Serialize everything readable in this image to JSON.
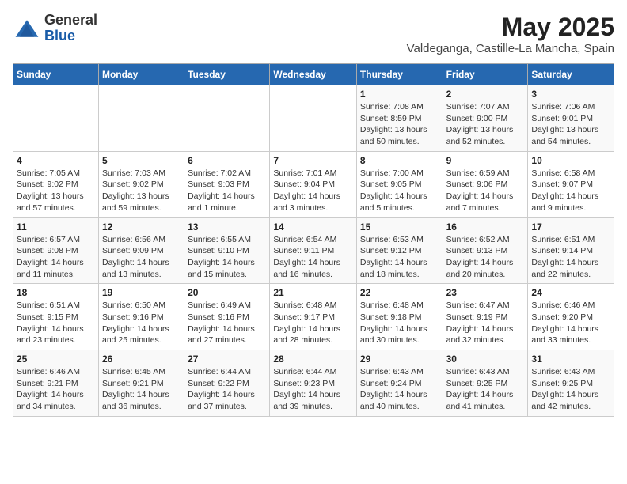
{
  "header": {
    "logo_general": "General",
    "logo_blue": "Blue",
    "month": "May 2025",
    "location": "Valdeganga, Castille-La Mancha, Spain"
  },
  "days_of_week": [
    "Sunday",
    "Monday",
    "Tuesday",
    "Wednesday",
    "Thursday",
    "Friday",
    "Saturday"
  ],
  "weeks": [
    [
      {
        "day": "",
        "info": ""
      },
      {
        "day": "",
        "info": ""
      },
      {
        "day": "",
        "info": ""
      },
      {
        "day": "",
        "info": ""
      },
      {
        "day": "1",
        "info": "Sunrise: 7:08 AM\nSunset: 8:59 PM\nDaylight: 13 hours and 50 minutes."
      },
      {
        "day": "2",
        "info": "Sunrise: 7:07 AM\nSunset: 9:00 PM\nDaylight: 13 hours and 52 minutes."
      },
      {
        "day": "3",
        "info": "Sunrise: 7:06 AM\nSunset: 9:01 PM\nDaylight: 13 hours and 54 minutes."
      }
    ],
    [
      {
        "day": "4",
        "info": "Sunrise: 7:05 AM\nSunset: 9:02 PM\nDaylight: 13 hours and 57 minutes."
      },
      {
        "day": "5",
        "info": "Sunrise: 7:03 AM\nSunset: 9:02 PM\nDaylight: 13 hours and 59 minutes."
      },
      {
        "day": "6",
        "info": "Sunrise: 7:02 AM\nSunset: 9:03 PM\nDaylight: 14 hours and 1 minute."
      },
      {
        "day": "7",
        "info": "Sunrise: 7:01 AM\nSunset: 9:04 PM\nDaylight: 14 hours and 3 minutes."
      },
      {
        "day": "8",
        "info": "Sunrise: 7:00 AM\nSunset: 9:05 PM\nDaylight: 14 hours and 5 minutes."
      },
      {
        "day": "9",
        "info": "Sunrise: 6:59 AM\nSunset: 9:06 PM\nDaylight: 14 hours and 7 minutes."
      },
      {
        "day": "10",
        "info": "Sunrise: 6:58 AM\nSunset: 9:07 PM\nDaylight: 14 hours and 9 minutes."
      }
    ],
    [
      {
        "day": "11",
        "info": "Sunrise: 6:57 AM\nSunset: 9:08 PM\nDaylight: 14 hours and 11 minutes."
      },
      {
        "day": "12",
        "info": "Sunrise: 6:56 AM\nSunset: 9:09 PM\nDaylight: 14 hours and 13 minutes."
      },
      {
        "day": "13",
        "info": "Sunrise: 6:55 AM\nSunset: 9:10 PM\nDaylight: 14 hours and 15 minutes."
      },
      {
        "day": "14",
        "info": "Sunrise: 6:54 AM\nSunset: 9:11 PM\nDaylight: 14 hours and 16 minutes."
      },
      {
        "day": "15",
        "info": "Sunrise: 6:53 AM\nSunset: 9:12 PM\nDaylight: 14 hours and 18 minutes."
      },
      {
        "day": "16",
        "info": "Sunrise: 6:52 AM\nSunset: 9:13 PM\nDaylight: 14 hours and 20 minutes."
      },
      {
        "day": "17",
        "info": "Sunrise: 6:51 AM\nSunset: 9:14 PM\nDaylight: 14 hours and 22 minutes."
      }
    ],
    [
      {
        "day": "18",
        "info": "Sunrise: 6:51 AM\nSunset: 9:15 PM\nDaylight: 14 hours and 23 minutes."
      },
      {
        "day": "19",
        "info": "Sunrise: 6:50 AM\nSunset: 9:16 PM\nDaylight: 14 hours and 25 minutes."
      },
      {
        "day": "20",
        "info": "Sunrise: 6:49 AM\nSunset: 9:16 PM\nDaylight: 14 hours and 27 minutes."
      },
      {
        "day": "21",
        "info": "Sunrise: 6:48 AM\nSunset: 9:17 PM\nDaylight: 14 hours and 28 minutes."
      },
      {
        "day": "22",
        "info": "Sunrise: 6:48 AM\nSunset: 9:18 PM\nDaylight: 14 hours and 30 minutes."
      },
      {
        "day": "23",
        "info": "Sunrise: 6:47 AM\nSunset: 9:19 PM\nDaylight: 14 hours and 32 minutes."
      },
      {
        "day": "24",
        "info": "Sunrise: 6:46 AM\nSunset: 9:20 PM\nDaylight: 14 hours and 33 minutes."
      }
    ],
    [
      {
        "day": "25",
        "info": "Sunrise: 6:46 AM\nSunset: 9:21 PM\nDaylight: 14 hours and 34 minutes."
      },
      {
        "day": "26",
        "info": "Sunrise: 6:45 AM\nSunset: 9:21 PM\nDaylight: 14 hours and 36 minutes."
      },
      {
        "day": "27",
        "info": "Sunrise: 6:44 AM\nSunset: 9:22 PM\nDaylight: 14 hours and 37 minutes."
      },
      {
        "day": "28",
        "info": "Sunrise: 6:44 AM\nSunset: 9:23 PM\nDaylight: 14 hours and 39 minutes."
      },
      {
        "day": "29",
        "info": "Sunrise: 6:43 AM\nSunset: 9:24 PM\nDaylight: 14 hours and 40 minutes."
      },
      {
        "day": "30",
        "info": "Sunrise: 6:43 AM\nSunset: 9:25 PM\nDaylight: 14 hours and 41 minutes."
      },
      {
        "day": "31",
        "info": "Sunrise: 6:43 AM\nSunset: 9:25 PM\nDaylight: 14 hours and 42 minutes."
      }
    ]
  ]
}
